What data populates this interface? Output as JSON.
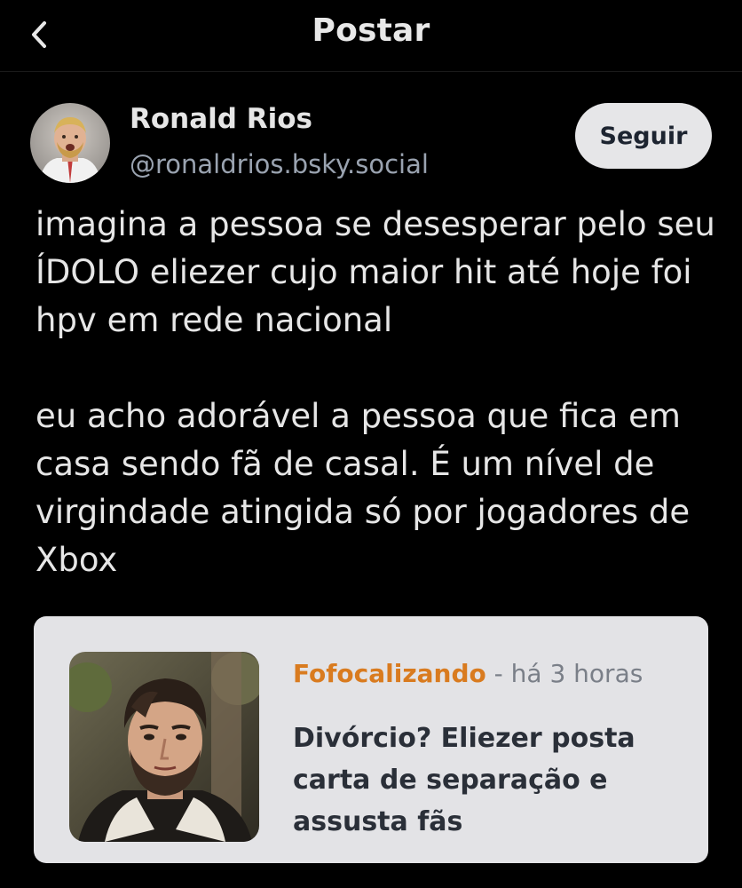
{
  "header": {
    "title": "Postar"
  },
  "post": {
    "author_name": "Ronald Rios",
    "author_handle": "@ronaldrios.bsky.social",
    "follow_label": "Seguir",
    "paragraph1": "imagina a pessoa se desesperar pelo seu ÍDOLO eliezer cujo maior hit até hoje foi hpv em rede nacional",
    "paragraph2": "eu acho adorável a pessoa que fica em casa sendo fã de casal. É um nível de virgindade atingida só por jogadores de Xbox"
  },
  "link_card": {
    "source": "Fofocalizando",
    "time_ago": "- há 3 horas",
    "title": "Divórcio? Eliezer posta carta de separação e assusta fãs"
  },
  "colors": {
    "background": "#000000",
    "text": "#e6e6e6",
    "handle": "#9aa3b0",
    "follow_button_bg": "#e6e6e8",
    "card_bg": "#e3e3e6",
    "source_accent": "#d97b1f"
  },
  "icons": {
    "back": "chevron-left-icon"
  }
}
